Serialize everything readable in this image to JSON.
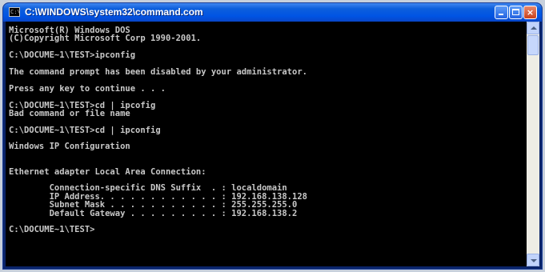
{
  "window": {
    "title": "C:\\WINDOWS\\system32\\command.com",
    "icon_name": "command-prompt-icon",
    "controls": {
      "minimize": "minimize-icon",
      "maximize": "maximize-icon",
      "close": "×"
    }
  },
  "console": {
    "lines": [
      "Microsoft(R) Windows DOS",
      "(C)Copyright Microsoft Corp 1990-2001.",
      "",
      "C:\\DOCUME~1\\TEST>ipconfig",
      "",
      "The command prompt has been disabled by your administrator.",
      "",
      "Press any key to continue . . .",
      "",
      "C:\\DOCUME~1\\TEST>cd | ipcofig",
      "Bad command or file name",
      "",
      "C:\\DOCUME~1\\TEST>cd | ipconfig",
      "",
      "Windows IP Configuration",
      "",
      "",
      "Ethernet adapter Local Area Connection:",
      "",
      "        Connection-specific DNS Suffix  . : localdomain",
      "        IP Address. . . . . . . . . . . . : 192.168.138.128",
      "        Subnet Mask . . . . . . . . . . . : 255.255.255.0",
      "        Default Gateway . . . . . . . . . : 192.168.138.2",
      "",
      "C:\\DOCUME~1\\TEST>"
    ]
  },
  "colors": {
    "console_bg": "#000000",
    "console_text": "#c8c8c8",
    "titlebar": "#0054e3"
  }
}
